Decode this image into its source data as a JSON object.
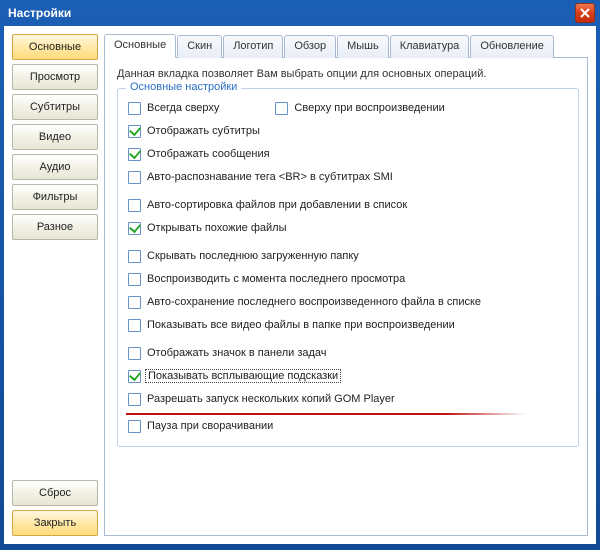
{
  "window": {
    "title": "Настройки"
  },
  "sidebar": {
    "items": [
      {
        "label": "Основные",
        "active": true
      },
      {
        "label": "Просмотр"
      },
      {
        "label": "Субтитры"
      },
      {
        "label": "Видео"
      },
      {
        "label": "Аудио"
      },
      {
        "label": "Фильтры"
      },
      {
        "label": "Разное"
      }
    ],
    "reset": "Сброс",
    "close": "Закрыть"
  },
  "tabs": [
    {
      "label": "Основные",
      "active": true
    },
    {
      "label": "Скин"
    },
    {
      "label": "Логотип"
    },
    {
      "label": "Обзор"
    },
    {
      "label": "Мышь"
    },
    {
      "label": "Клавиатура"
    },
    {
      "label": "Обновление"
    }
  ],
  "panel": {
    "description": "Данная вкладка позволяет Вам выбрать опции для основных операций.",
    "legend": "Основные настройки",
    "options": [
      {
        "label": "Всегда сверху",
        "checked": false,
        "pair": {
          "label": "Сверху при воспроизведении",
          "checked": false
        }
      },
      {
        "label": "Отображать субтитры",
        "checked": true
      },
      {
        "label": "Отображать сообщения",
        "checked": true
      },
      {
        "label": "Авто-распознавание тега <BR> в субтитрах SMI",
        "checked": false
      },
      {
        "gap": true,
        "label": "Авто-сортировка файлов при добавлении в список",
        "checked": false
      },
      {
        "label": "Открывать похожие файлы",
        "checked": true
      },
      {
        "gap": true,
        "label": "Скрывать последнюю загруженную папку",
        "checked": false
      },
      {
        "label": "Воспроизводить с момента последнего просмотра",
        "checked": false
      },
      {
        "label": "Авто-сохранение последнего воспроизведенного файла в списке",
        "checked": false
      },
      {
        "label": "Показывать все видео файлы в папке при воспроизведении",
        "checked": false
      },
      {
        "gap": true,
        "label": "Отображать значок в панели задач",
        "checked": false
      },
      {
        "label": "Показывать всплывающие подсказки",
        "checked": true,
        "focused": true
      },
      {
        "label": "Разрешать запуск нескольких копий GOM Player",
        "checked": false,
        "underline": true
      },
      {
        "label": "Пауза при сворачивании",
        "checked": false
      }
    ]
  }
}
